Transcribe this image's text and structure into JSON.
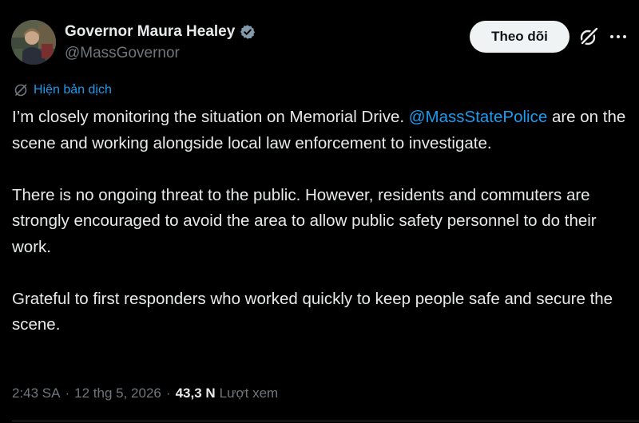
{
  "author": {
    "display_name": "Governor Maura Healey",
    "handle": "@MassGovernor",
    "verified": true
  },
  "actions": {
    "follow_label": "Theo dõi",
    "more_label": "···"
  },
  "translate": {
    "label": "Hiện bản dịch"
  },
  "tweet": {
    "p1_before": "I’m closely monitoring the situation on Memorial Drive. ",
    "p1_mention": "@MassStatePolice",
    "p1_after": " are on the scene and working alongside local law enforcement to investigate.",
    "p2": "There is no ongoing threat to the public. However, residents and commuters are strongly encouraged to avoid the area to allow public safety personnel to do their work.",
    "p3": "Grateful to first responders who worked quickly to keep people safe and secure the scene."
  },
  "meta": {
    "time": "2:43 SA",
    "separator": "·",
    "date": "12 thg 5, 2026",
    "views_count": "43,3 N",
    "views_label": "Lượt xem"
  },
  "colors": {
    "background": "#000000",
    "text": "#e7e9ea",
    "muted": "#71767b",
    "link": "#1d9bf0",
    "verified_badge": "#829aab",
    "follow_bg": "#eff3f4"
  }
}
